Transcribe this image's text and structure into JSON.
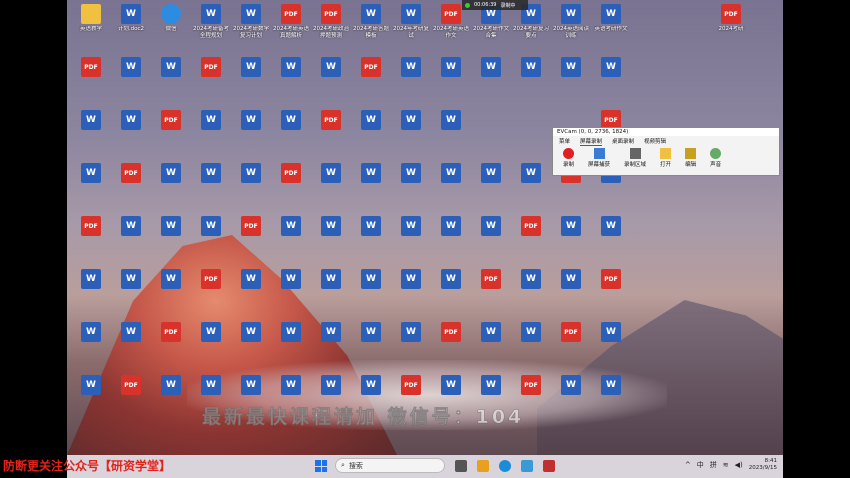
{
  "desktop": {
    "icons": [
      {
        "type": "folder",
        "label": "英语教学"
      },
      {
        "type": "word",
        "label": "计划.doc2"
      },
      {
        "type": "app",
        "label": "微信"
      },
      {
        "type": "word",
        "label": "2024考研备考全程规划"
      },
      {
        "type": "word",
        "label": "2024考研数学复习计划"
      },
      {
        "type": "pdf",
        "label": "2024考研英语真题解析"
      },
      {
        "type": "pdf",
        "label": "2024考研政治押题预测"
      },
      {
        "type": "word",
        "label": "2024考研答题模板"
      },
      {
        "type": "word",
        "label": "2024年考研复试"
      },
      {
        "type": "pdf",
        "label": "2024考研英语作文"
      },
      {
        "type": "word",
        "label": "2024考研作文合集"
      },
      {
        "type": "word",
        "label": "2024考研复习要点"
      },
      {
        "type": "word",
        "label": "2024英语阅读训练"
      },
      {
        "type": "word",
        "label": "英语考研作文"
      },
      {
        "type": "pdf",
        "label": "2024考研"
      }
    ],
    "record_indicator": "00:06:39",
    "record_indicator_status": "录制中",
    "watermark": "最新最快课程请加 微信号：104"
  },
  "ev_window": {
    "title": "EVCam (0, 0, 2736, 1824)",
    "tabs": [
      "菜单",
      "屏幕录制",
      "桌面录制",
      "视频剪辑"
    ],
    "tools": [
      "录制",
      "屏幕捕获",
      "录制区域",
      "打开",
      "编辑",
      "声音"
    ]
  },
  "taskbar": {
    "search_placeholder": "搜索",
    "lang_indicator": "中",
    "input_mode": "拼",
    "time": "8:41",
    "date": "2023/9/15"
  },
  "caption": "防断更关注公众号【研资学堂】"
}
